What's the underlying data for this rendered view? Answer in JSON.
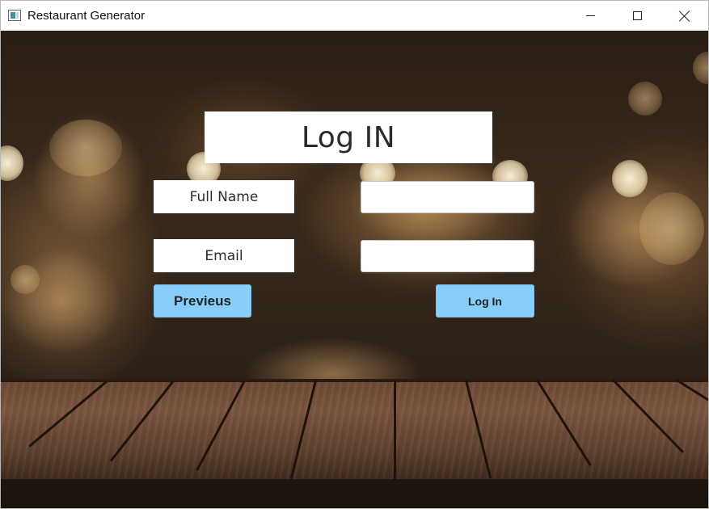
{
  "window": {
    "title": "Restaurant Generator",
    "controls": [
      "minimize",
      "maximize",
      "close"
    ]
  },
  "form": {
    "heading": "Log IN",
    "full_name_label": "Full Name",
    "full_name_value": "",
    "email_label": "Email",
    "email_value": "",
    "previous_button": "Previeus",
    "login_button": "Log In"
  },
  "colors": {
    "button_fill": "#87cefa",
    "panel_fill": "#ffffff",
    "text": "#2b2b2b"
  },
  "icons": {
    "app": "app-window-icon",
    "minimize": "minimize-icon",
    "maximize": "maximize-icon",
    "close": "close-icon"
  }
}
